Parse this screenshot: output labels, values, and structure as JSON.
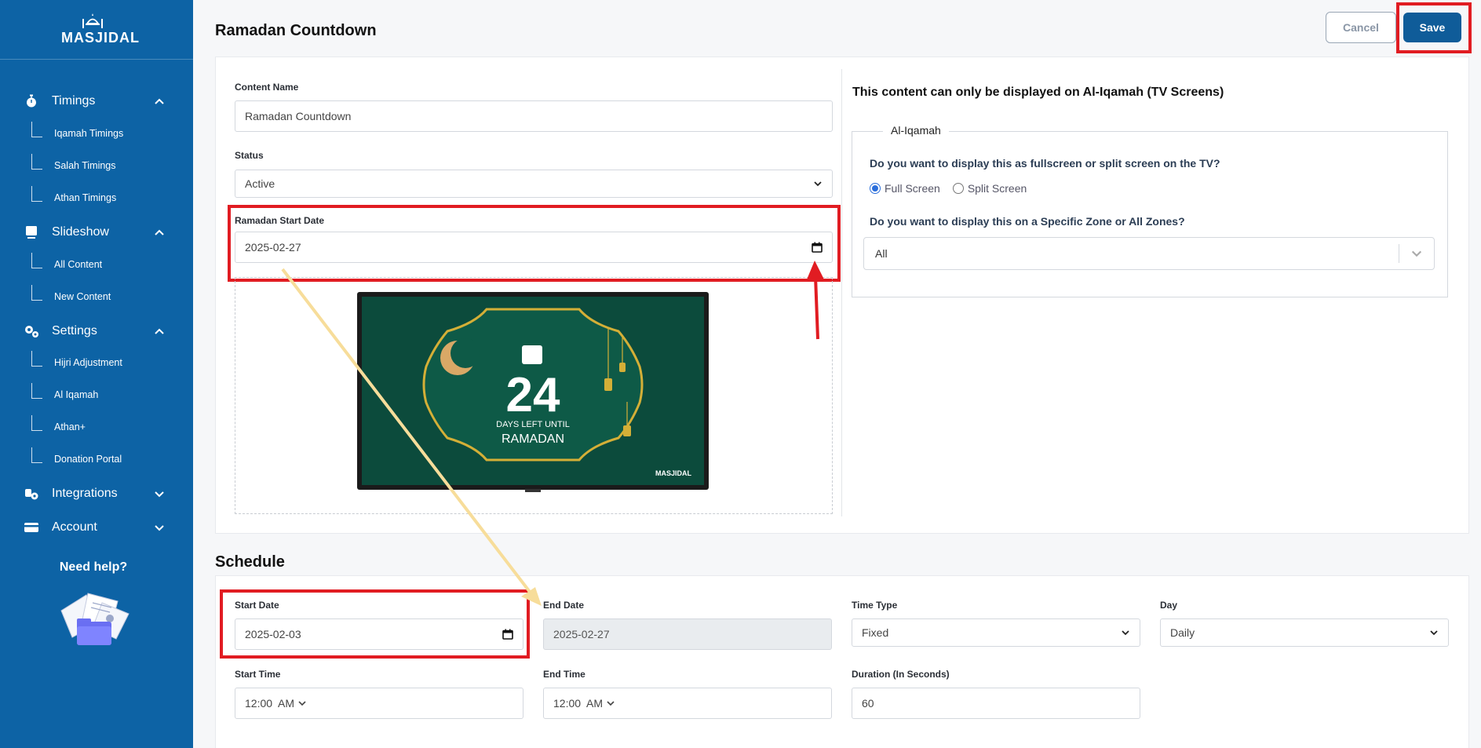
{
  "sidebar": {
    "logo_text": "MASJIDAL",
    "sections": [
      {
        "label": "Timings",
        "icon": "stopwatch-icon",
        "expanded": true,
        "items": [
          {
            "label": "Iqamah Timings"
          },
          {
            "label": "Salah Timings"
          },
          {
            "label": "Athan Timings"
          }
        ]
      },
      {
        "label": "Slideshow",
        "icon": "slideshow-icon",
        "expanded": true,
        "items": [
          {
            "label": "All Content"
          },
          {
            "label": "New Content"
          }
        ]
      },
      {
        "label": "Settings",
        "icon": "gears-icon",
        "expanded": true,
        "items": [
          {
            "label": "Hijri Adjustment"
          },
          {
            "label": "Al Iqamah"
          },
          {
            "label": "Athan+"
          },
          {
            "label": "Donation Portal"
          }
        ]
      },
      {
        "label": "Integrations",
        "icon": "integrations-icon",
        "expanded": false,
        "items": []
      },
      {
        "label": "Account",
        "icon": "credit-card-icon",
        "expanded": false,
        "items": []
      }
    ],
    "help_label": "Need help?"
  },
  "header": {
    "title": "Ramadan Countdown",
    "cancel_label": "Cancel",
    "save_label": "Save"
  },
  "content_form": {
    "content_name_label": "Content Name",
    "content_name_value": "Ramadan Countdown",
    "status_label": "Status",
    "status_value": "Active",
    "ramadan_start_label": "Ramadan Start Date",
    "ramadan_start_value": "2025-02-27"
  },
  "preview": {
    "number": "24",
    "line1": "DAYS LEFT UNTIL",
    "line2": "RAMADAN",
    "brand": "MASJIDAL",
    "background_color": "#0c4b3c",
    "frame_color": "#d4af37"
  },
  "display": {
    "title": "This content can only be displayed on Al-Iqamah (TV Screens)",
    "legend": "Al-Iqamah",
    "screen_question": "Do you want to display this as fullscreen or split screen on the TV?",
    "options": [
      {
        "label": "Full Screen",
        "selected": true
      },
      {
        "label": "Split Screen",
        "selected": false
      }
    ],
    "zone_question": "Do you want to display this on a Specific Zone or All Zones?",
    "zone_value": "All"
  },
  "schedule": {
    "title": "Schedule",
    "start_date_label": "Start Date",
    "start_date_value": "2025-02-03",
    "end_date_label": "End Date",
    "end_date_value": "2025-02-27",
    "time_type_label": "Time Type",
    "time_type_value": "Fixed",
    "day_label": "Day",
    "day_value": "Daily",
    "start_time_label": "Start Time",
    "start_time_value": "12:00  AM",
    "end_time_label": "End Time",
    "end_time_value": "12:00  AM",
    "duration_label": "Duration (In Seconds)",
    "duration_value": "60"
  },
  "colors": {
    "sidebar": "#0d63a5",
    "save_button": "#0f5c99",
    "highlight": "#e11c22",
    "arrow": "#f7dd9a"
  }
}
